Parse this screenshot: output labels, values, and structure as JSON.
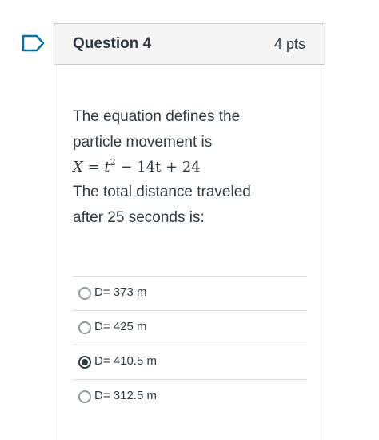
{
  "question": {
    "title": "Question 4",
    "points": "4 pts",
    "text_line1": "The equation defines the",
    "text_line2": "particle movement is",
    "equation": {
      "lhs": "X",
      "eq": " = ",
      "t1": "t",
      "exp": "2",
      "rest": " − 14t + 24"
    },
    "text_line3": "The total distance traveled",
    "text_line4": "after 25 seconds is:"
  },
  "answers": [
    {
      "label": "D= 373 m",
      "selected": false
    },
    {
      "label": "D= 425 m",
      "selected": false
    },
    {
      "label": "D= 410.5 m",
      "selected": true
    },
    {
      "label": "D= 312.5 m",
      "selected": false
    }
  ],
  "colors": {
    "text": "#2d3b45",
    "border": "#c7cdd1",
    "header_bg": "#f5f5f5",
    "flag": "#0770a3"
  },
  "icons": {
    "flag": "flag-icon",
    "radio": "radio-button"
  }
}
